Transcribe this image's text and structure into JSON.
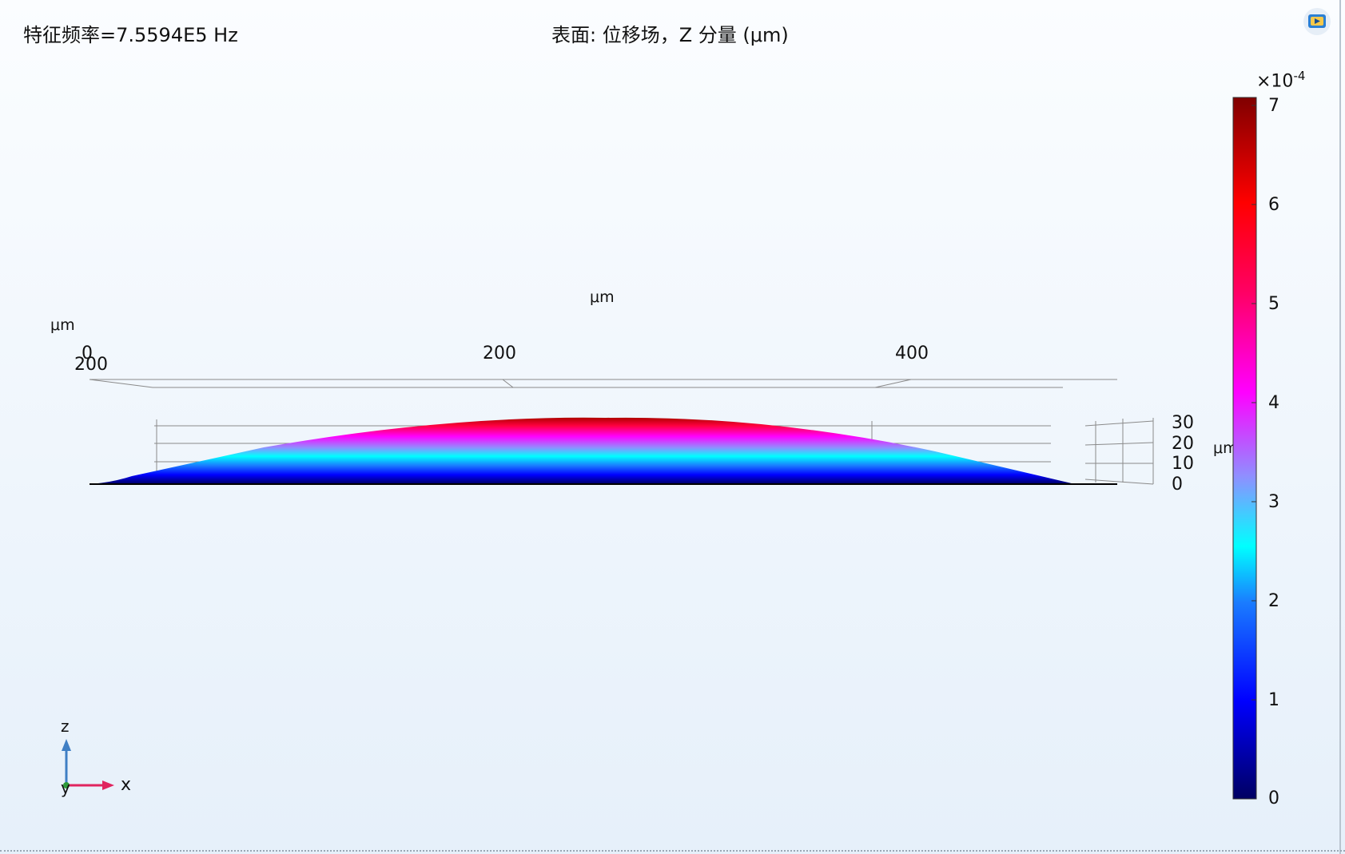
{
  "header": {
    "eigenfrequency": "特征频率=7.5594E5 Hz",
    "plot_title": "表面: 位移场，Z 分量 (μm)"
  },
  "axes": {
    "x_unit": "μm",
    "x_ticks": [
      "0",
      "200",
      "400"
    ],
    "y_unit": "μm",
    "y_ticks": [
      "200"
    ],
    "z_unit": "μm",
    "z_ticks": [
      "30",
      "20",
      "10",
      "0"
    ]
  },
  "triad": {
    "z": "z",
    "y": "y",
    "x": "x"
  },
  "colorbar": {
    "exponent_base": "×10",
    "exponent_power": "-4",
    "ticks": [
      "7",
      "6",
      "5",
      "4",
      "3",
      "2",
      "1",
      "0"
    ],
    "range": [
      0,
      7.2
    ],
    "colors": [
      "#000062",
      "#0000ff",
      "#1a7cff",
      "#00ffff",
      "#8f8fff",
      "#ff00ff",
      "#ff0066",
      "#ff0000",
      "#800000"
    ]
  },
  "icons": {
    "corner": "comsol-window-icon"
  }
}
